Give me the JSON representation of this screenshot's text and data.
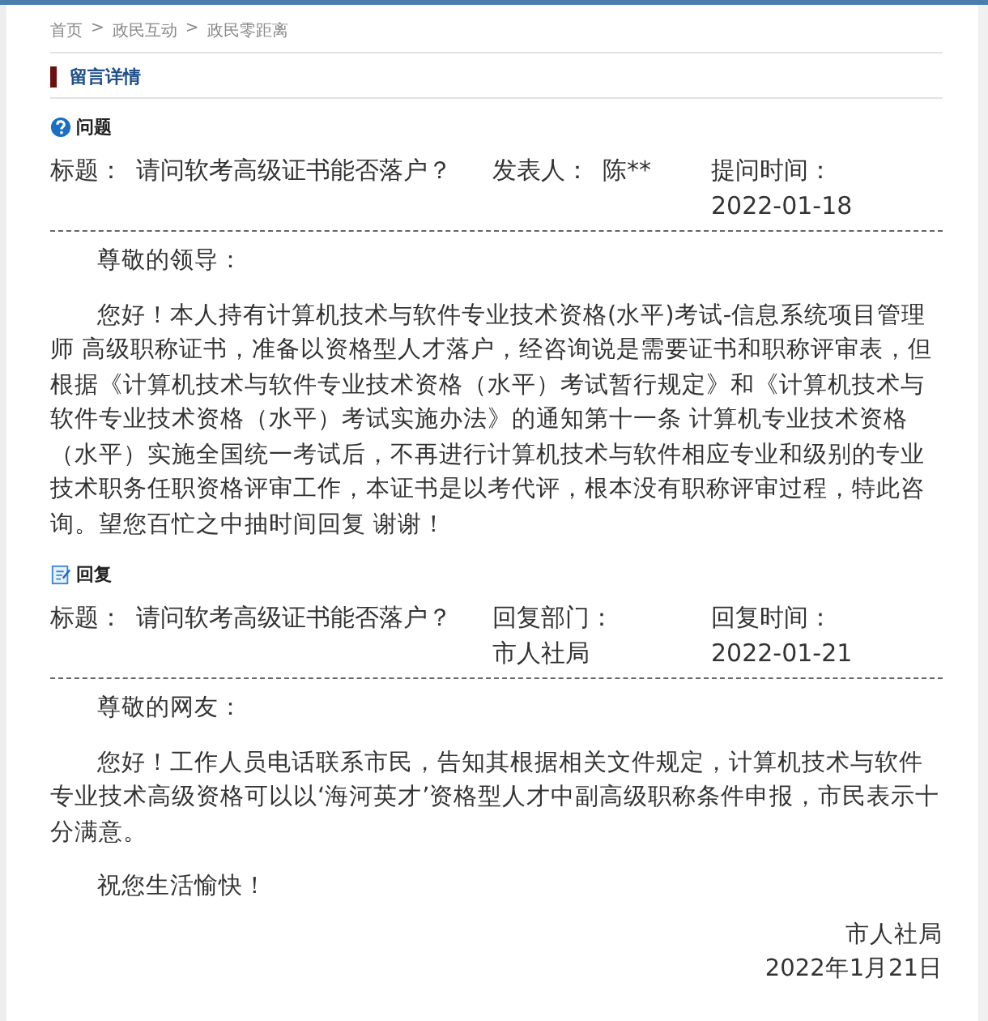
{
  "breadcrumb": [
    "首页",
    "政民互动",
    "政民零距离"
  ],
  "breadcrumb_separator": ">",
  "section_title": "留言详情",
  "question": {
    "heading": "问题",
    "fields": [
      {
        "label": "标题：",
        "value": "请问软考高级证书能否落户？"
      },
      {
        "label": "发表人：",
        "value": "陈**"
      },
      {
        "label": "提问时间：",
        "value": "2022-01-18"
      }
    ],
    "paragraphs": [
      "尊敬的领导：",
      "您好！本人持有计算机技术与软件专业技术资格(水平)考试-信息系统项目管理师 高级职称证书，准备以资格型人才落户，经咨询说是需要证书和职称评审表，但根据《计算机技术与软件专业技术资格（水平）考试暂行规定》和《计算机技术与软件专业技术资格（水平）考试实施办法》的通知第十一条 计算机专业技术资格（水平）实施全国统一考试后，不再进行计算机技术与软件相应专业和级别的专业技术职务任职资格评审工作，本证书是以考代评，根本没有职称评审过程，特此咨询。望您百忙之中抽时间回复 谢谢！"
    ]
  },
  "reply": {
    "heading": "回复",
    "fields": [
      {
        "label": "标题：",
        "value": "请问软考高级证书能否落户？"
      },
      {
        "label": "回复部门：",
        "value": "市人社局"
      },
      {
        "label": "回复时间：",
        "value": "2022-01-21"
      }
    ],
    "paragraphs": [
      "尊敬的网友：",
      "您好！工作人员电话联系市民，告知其根据相关文件规定，计算机技术与软件专业技术高级资格可以以‘海河英才’资格型人才中副高级职称条件申报，市民表示十分满意。",
      "祝您生活愉快！"
    ],
    "signature": [
      "市人社局",
      "2022年1月21日"
    ]
  }
}
